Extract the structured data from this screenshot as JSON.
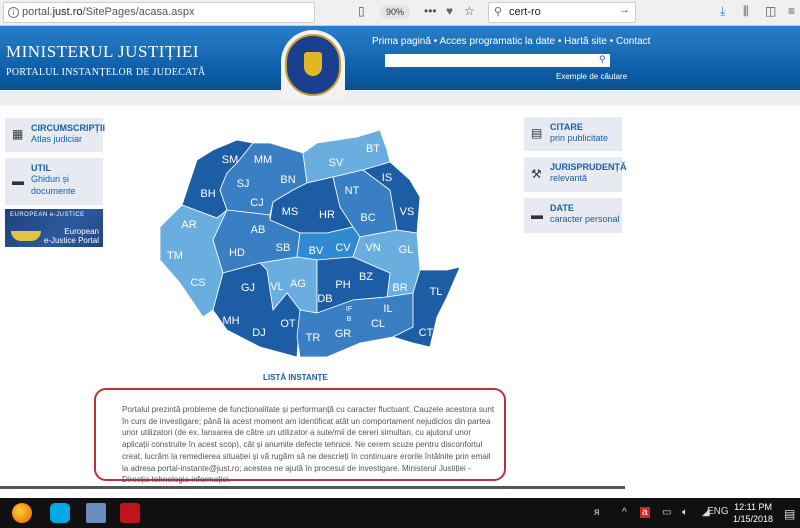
{
  "browser": {
    "url_host": "portal.",
    "url_domain": "just.ro",
    "url_path": "/SitePages/acasa.aspx",
    "zoom": "90%",
    "search_value": "cert-ro"
  },
  "header": {
    "title": "MINISTERUL JUSTIȚIEI",
    "subtitle": "PORTALUL INSTANȚELOR DE JUDECATĂ",
    "nav": [
      "Prima pagină",
      "Acces programatic la date",
      "Hartă site",
      "Contact"
    ],
    "nav_sep": " • ",
    "search_placeholder": "",
    "examples": "Exemple de căutare"
  },
  "left_tiles": [
    {
      "title": "CIRCUMSCRIPȚII",
      "sub": "Atlas judiciar",
      "icon": "map-icon"
    },
    {
      "title": "UTIL",
      "sub": "Ghiduri și documente",
      "icon": "folder-icon"
    }
  ],
  "ejustice": {
    "logo": "EUROPEAN e-JUSTICE",
    "line1": "European",
    "line2": "e-Justice Portal"
  },
  "right_tiles": [
    {
      "title": "CITARE",
      "sub": "prin publicitate",
      "icon": "calendar-icon"
    },
    {
      "title": "JURISPRUDENȚĂ",
      "sub": "relevantă",
      "icon": "gavel-icon"
    },
    {
      "title": "DATE",
      "sub": "caracter personal",
      "icon": "folder-icon"
    }
  ],
  "map": {
    "counties": [
      "SM",
      "MM",
      "BN",
      "SJ",
      "BH",
      "CJ",
      "SV",
      "BT",
      "IS",
      "NT",
      "VS",
      "MS",
      "HR",
      "BC",
      "AR",
      "AB",
      "SB",
      "BV",
      "CV",
      "VN",
      "GL",
      "HD",
      "TM",
      "CS",
      "GJ",
      "VL",
      "AG",
      "PH",
      "BZ",
      "BR",
      "TL",
      "DB",
      "IF",
      "B",
      "IL",
      "MH",
      "OT",
      "CL",
      "DJ",
      "GR",
      "TR",
      "CT"
    ],
    "colors": {
      "dark": "#1c5da6",
      "medium": "#3a7fc4",
      "bright": "#2f8ad1",
      "light": "#6aaee0"
    },
    "link": "LISTĂ INSTANȚE"
  },
  "notice": "Portalul prezintă probleme de funcționalitate și performanță cu caracter fluctuant. Cauzele acestora sunt în curs de investigare; până la acest moment am identificat atât un comportament nejudicios din partea unor utilizatori (de ex. lansarea de către un utilizator a sute/mii de cereri simultan, cu ajutorul unor aplicații construite în acest scop), cât și anumite defecte tehnice. Ne cerem scuze pentru disconfortul creat, lucrăm la remedierea situației și vă rugăm să ne descrieți în continuare erorile întâlnite prin email la adresa portal-instante@just.ro; acestea ne ajută în procesul de investigare. Ministerul Justiției - Direcția tehnologia informației.",
  "taskbar": {
    "lang": "ENG",
    "time": "12:11 PM",
    "date": "1/15/2018"
  }
}
